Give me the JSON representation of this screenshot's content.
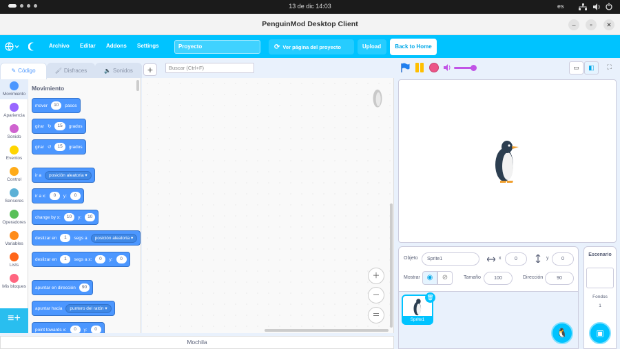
{
  "system": {
    "clock": "13 de dic  14:03",
    "lang": "es"
  },
  "window": {
    "title": "PenguinMod Desktop Client",
    "minimize": "–",
    "maximize": "▫",
    "close": "✕"
  },
  "menu": {
    "archivo": "Archivo",
    "editar": "Editar",
    "addons": "Addons",
    "settings": "Settings",
    "project_name": "Proyecto",
    "see_project": "Ver página del proyecto",
    "upload": "Upload",
    "back_home": "Back to Home"
  },
  "tabs": {
    "code": "Código",
    "costumes": "Disfraces",
    "sounds": "Sonidos"
  },
  "search": {
    "placeholder": "Buscar (Ctrl+F)"
  },
  "categories": [
    {
      "label": "Movimiento",
      "color": "#4c97ff"
    },
    {
      "label": "Apariencia",
      "color": "#9966ff"
    },
    {
      "label": "Sonido",
      "color": "#cf63cf"
    },
    {
      "label": "Eventos",
      "color": "#ffd500"
    },
    {
      "label": "Control",
      "color": "#ffab19"
    },
    {
      "label": "Sensores",
      "color": "#5cb1d6"
    },
    {
      "label": "Operadores",
      "color": "#59c059"
    },
    {
      "label": "Variables",
      "color": "#ff8c1a"
    },
    {
      "label": "Lists",
      "color": "#ff661a"
    },
    {
      "label": "Mis bloques",
      "color": "#ff6680"
    }
  ],
  "palette": {
    "header": "Movimiento",
    "b1": {
      "a": "mover",
      "v": "10",
      "b": "pasos"
    },
    "b2": {
      "a": "girar",
      "v": "15",
      "b": "grados"
    },
    "b3": {
      "a": "girar",
      "v": "15",
      "b": "grados"
    },
    "b4": {
      "a": "ir a",
      "dd": "posición aleatoria"
    },
    "b5": {
      "a": "ir a x:",
      "v1": "0",
      "b": "y:",
      "v2": "0"
    },
    "b6": {
      "a": "change by x:",
      "v1": "10",
      "b": "y:",
      "v2": "10"
    },
    "b7": {
      "a": "deslizar en",
      "v": "1",
      "b": "segs a",
      "dd": "posición aleatoria"
    },
    "b8": {
      "a": "deslizar en",
      "v1": "1",
      "b": "segs a x:",
      "v2": "0",
      "c": "y:",
      "v3": "0"
    },
    "b9": {
      "a": "apuntar en dirección",
      "v": "90"
    },
    "b10": {
      "a": "apuntar hacia",
      "dd": "puntero del ratón"
    },
    "b11": {
      "a": "point towards x:",
      "v1": "0",
      "b": "y:",
      "v2": "0"
    }
  },
  "backpack": "Mochila",
  "sprite_info": {
    "obj_label": "Objeto",
    "name": "Sprite1",
    "x_label": "x",
    "x": "0",
    "y_label": "y",
    "y": "0",
    "show_label": "Mostrar",
    "size_label": "Tamaño",
    "size": "100",
    "dir_label": "Dirección",
    "direction": "90"
  },
  "sprites": [
    {
      "name": "Sprite1"
    }
  ],
  "stage_panel": {
    "title": "Escenario",
    "backdrops_label": "Fondos",
    "backdrops_count": "1"
  }
}
